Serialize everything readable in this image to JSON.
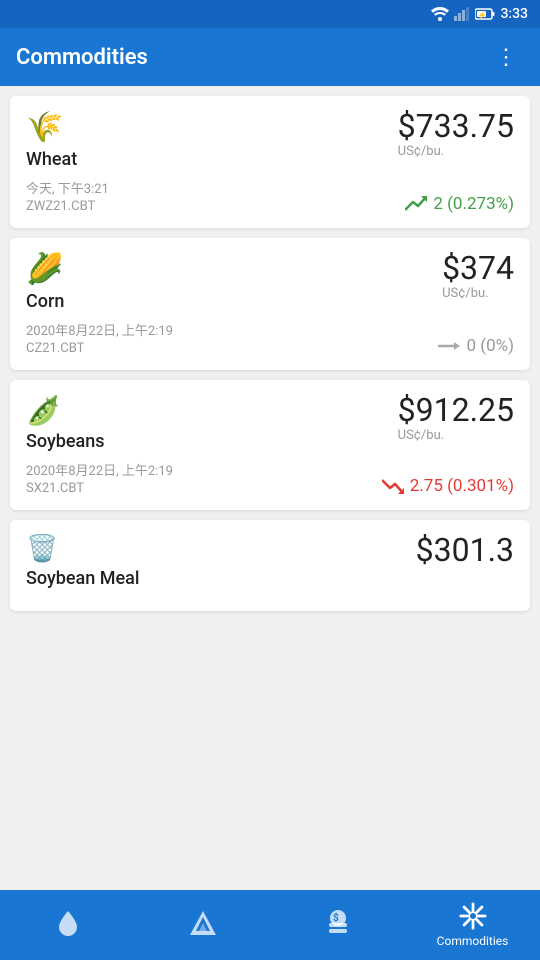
{
  "statusBar": {
    "time": "3:33"
  },
  "appBar": {
    "title": "Commodities",
    "menuIcon": "⋮"
  },
  "commodities": [
    {
      "id": "wheat",
      "name": "Wheat",
      "symbol": "ZWZ21.CBT",
      "date": "今天, 下午3:21",
      "price": "$733.75",
      "unit": "US¢/bu.",
      "change": "2 (0.273%)",
      "direction": "up",
      "icon": "🌾"
    },
    {
      "id": "corn",
      "name": "Corn",
      "symbol": "CZ21.CBT",
      "date": "2020年8月22日, 上午2:19",
      "price": "$374",
      "unit": "US¢/bu.",
      "change": "0 (0%)",
      "direction": "neutral",
      "icon": "🌽"
    },
    {
      "id": "soybeans",
      "name": "Soybeans",
      "symbol": "SX21.CBT",
      "date": "2020年8月22日, 上午2:19",
      "price": "$912.25",
      "unit": "US¢/bu.",
      "change": "2.75 (0.301%)",
      "direction": "down",
      "icon": "🫘"
    },
    {
      "id": "soybean-meal",
      "name": "Soybean Meal",
      "symbol": "",
      "date": "",
      "price": "$301.3",
      "unit": "",
      "change": "",
      "direction": "neutral",
      "icon": "🗑"
    }
  ],
  "bottomNav": [
    {
      "id": "oil",
      "label": "",
      "icon": "💧",
      "active": false
    },
    {
      "id": "energy",
      "label": "",
      "icon": "⚡",
      "active": false
    },
    {
      "id": "metals",
      "label": "",
      "icon": "💰",
      "active": false
    },
    {
      "id": "commodities",
      "label": "Commodities",
      "icon": "snowflake",
      "active": true
    }
  ]
}
